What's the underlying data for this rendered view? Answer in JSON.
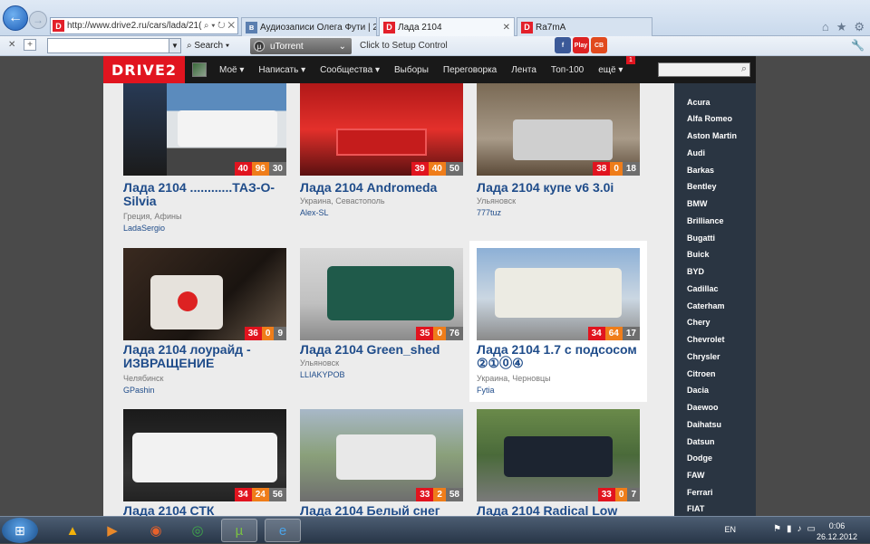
{
  "browser": {
    "address": "http://www.drive2.ru/cars/lada/21(",
    "address_tools": "⌕ ▾ ↻ ✕",
    "tabs": [
      {
        "label": "Аудиозаписи Олега Фути | 20..."
      },
      {
        "label": "Лада 2104"
      },
      {
        "label": "Ra7mA"
      }
    ],
    "toolbar": {
      "search_label": "Search",
      "utorrent_label": "uTorrent",
      "setup_text": "Click to Setup Control",
      "social": [
        "f",
        "Play",
        "CB"
      ]
    }
  },
  "site": {
    "logo": "DRIVE2",
    "menu": [
      "Моё ▾",
      "Написать ▾",
      "Сообщества ▾",
      "Выборы",
      "Переговорка",
      "Лента",
      "Топ-100",
      "ещё ▾"
    ],
    "feed_badge": "1"
  },
  "cards": [
    {
      "title": "Лада 2104 ............ТАЗ-О-Silvia",
      "location": "Греция, Афины",
      "user": "LadaSergio",
      "stats": [
        "40",
        "96",
        "30"
      ]
    },
    {
      "title": "Лада 2104 Andromeda",
      "location": "Украина, Севастополь",
      "user": "Alex-SL",
      "stats": [
        "39",
        "40",
        "50"
      ]
    },
    {
      "title": "Лада 2104 купе v6 3.0i",
      "location": "Ульяновск",
      "user": "777tuz",
      "stats": [
        "38",
        "0",
        "18"
      ]
    },
    {
      "title": "Лада 2104 лоурайд - ИЗВРАЩЕНИЕ",
      "location": "Челябинск",
      "user": "GPashin",
      "stats": [
        "36",
        "0",
        "9"
      ]
    },
    {
      "title": "Лада 2104 Green_shed",
      "location": "Ульяновск",
      "user": "LLIAKYPOB",
      "stats": [
        "35",
        "0",
        "76"
      ]
    },
    {
      "title": "Лада 2104 1.7 с подсосом ②①⓪④",
      "location": "Украина, Черновцы",
      "user": "Fytia",
      "stats": [
        "34",
        "64",
        "17"
      ]
    },
    {
      "title": "Лада 2104 СТК",
      "location": "",
      "user": "",
      "stats": [
        "34",
        "24",
        "56"
      ]
    },
    {
      "title": "Лада 2104 Белый снег",
      "location": "",
      "user": "",
      "stats": [
        "33",
        "2",
        "58"
      ]
    },
    {
      "title": "Лада 2104 Radical Low",
      "location": "",
      "user": "",
      "stats": [
        "33",
        "0",
        "7"
      ]
    }
  ],
  "brands": [
    "Acura",
    "Alfa Romeo",
    "Aston Martin",
    "Audi",
    "Barkas",
    "Bentley",
    "BMW",
    "Brilliance",
    "Bugatti",
    "Buick",
    "BYD",
    "Cadillac",
    "Caterham",
    "Chery",
    "Chevrolet",
    "Chrysler",
    "Citroen",
    "Dacia",
    "Daewoo",
    "Daihatsu",
    "Datsun",
    "Dodge",
    "FAW",
    "Ferrari",
    "FIAT"
  ],
  "taskbar": {
    "lang": "EN",
    "time": "0:06",
    "date": "26.12.2012"
  },
  "colors": {
    "accent": "#e1141f",
    "stat_orange": "#ef7d1a",
    "link": "#1f4c8a",
    "header_bg": "#191919",
    "sidebar_bg": "#2a3542"
  }
}
